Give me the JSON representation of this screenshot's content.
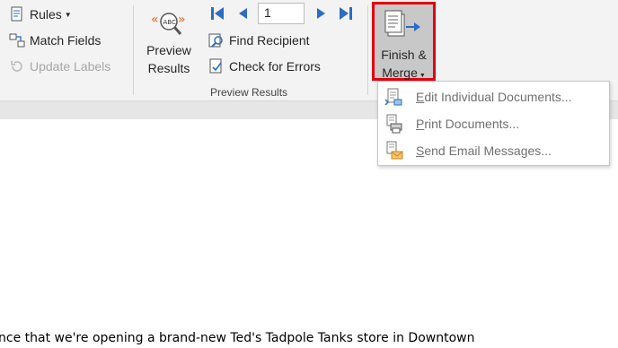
{
  "ribbon": {
    "write_insert_group": {
      "rules_label": "Rules",
      "match_fields_label": "Match Fields",
      "update_labels_label": "Update Labels"
    },
    "preview_group": {
      "preview_results_line1": "Preview",
      "preview_results_line2": "Results",
      "record_number": "1",
      "find_recipient_label": "Find Recipient",
      "check_errors_label": "Check for Errors",
      "group_label": "Preview Results"
    },
    "finish_group": {
      "finish_line1": "Finish &",
      "finish_line2": "Merge"
    }
  },
  "dropdown_menu": {
    "items": [
      {
        "label_pre": "",
        "accel": "E",
        "label_post": "dit Individual Documents...",
        "icon": "edit-documents-icon"
      },
      {
        "label_pre": "",
        "accel": "P",
        "label_post": "rint Documents...",
        "icon": "print-documents-icon"
      },
      {
        "label_pre": "",
        "accel": "S",
        "label_post": "end Email Messages...",
        "icon": "send-email-icon"
      }
    ]
  },
  "document": {
    "visible_line": "nce that we're opening a brand-new Ted's Tadpole Tanks store in Downtown"
  },
  "colors": {
    "ribbon_bg": "#f3f3f3",
    "nav_blue": "#2b6cc4",
    "highlight_red": "#e3000f",
    "finish_bg": "#c8c8c8",
    "menu_text": "#707070"
  }
}
